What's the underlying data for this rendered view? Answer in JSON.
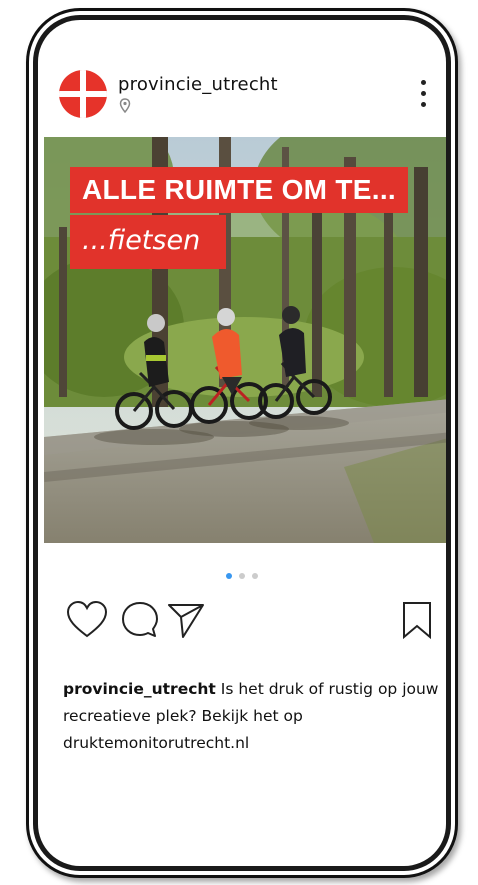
{
  "post": {
    "username": "provincie_utrecht",
    "image_title_line1": "ALLE RUIMTE OM TE...",
    "image_title_line2": "...fietsen",
    "caption_user": "provincie_utrecht",
    "caption_text": "Is het druk of rustig op jouw recreatieve plek? Bekijk het op druktemonitorutrecht.nl",
    "carousel": {
      "count": 3,
      "active_index": 0
    }
  },
  "icons": {
    "location": "location-pin-icon",
    "more": "more-vertical-icon",
    "like": "heart-icon",
    "comment": "comment-icon",
    "share": "send-icon",
    "save": "bookmark-icon"
  },
  "colors": {
    "brand_red": "#e1332b",
    "active_dot": "#3897f0"
  }
}
